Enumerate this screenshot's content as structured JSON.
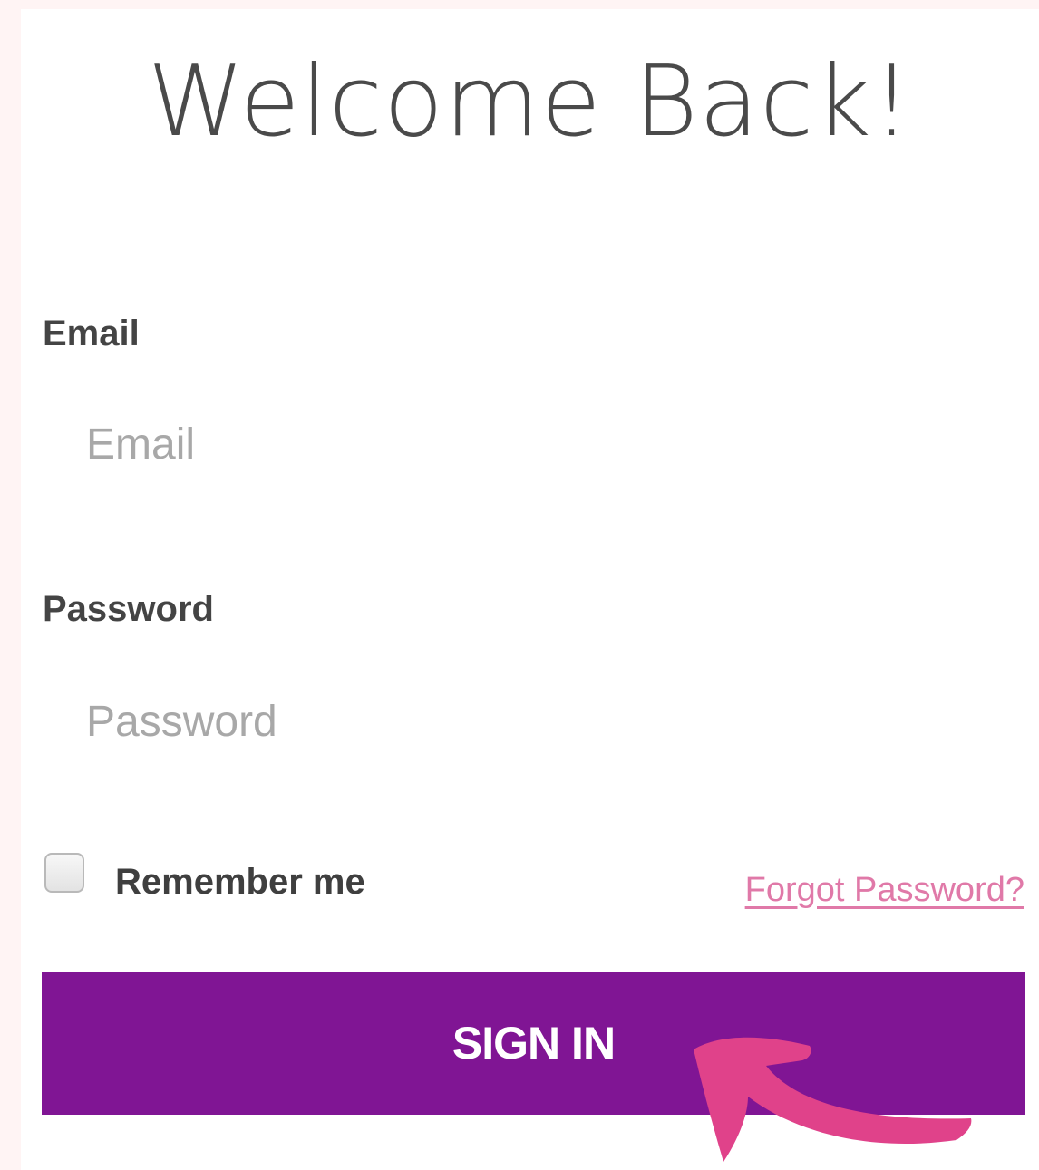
{
  "form": {
    "title": "Welcome Back!",
    "email_label": "Email",
    "email_placeholder": "Email",
    "email_value": "",
    "password_label": "Password",
    "password_placeholder": "Password",
    "password_value": "",
    "remember_label": "Remember me",
    "remember_checked": false,
    "forgot_link": "Forgot Password?",
    "submit_label": "SIGN IN"
  },
  "colors": {
    "background": "#fff4f4",
    "button": "#801594",
    "link": "#e079a8",
    "arrow": "#e0428a"
  },
  "icons": {
    "annotation": "curved-arrow-icon"
  }
}
